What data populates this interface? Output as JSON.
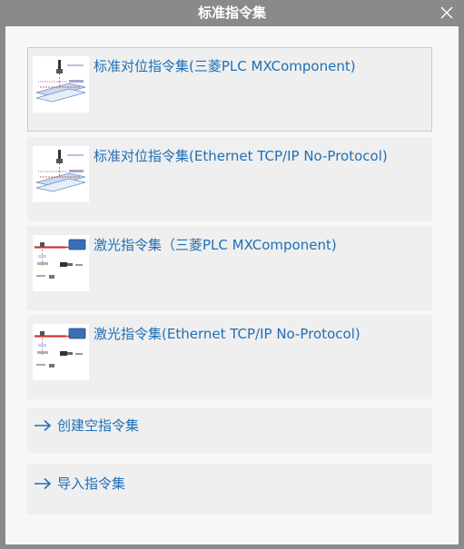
{
  "window": {
    "title": "标准指令集",
    "close_icon": "close-icon"
  },
  "templates": [
    {
      "label": "标准对位指令集(三菱PLC MXComponent)",
      "icon": "alignment-diagram-icon",
      "selected": true
    },
    {
      "label": "标准对位指令集(Ethernet TCP/IP No-Protocol)",
      "icon": "alignment-diagram-icon",
      "selected": false
    },
    {
      "label": "激光指令集（三菱PLC MXComponent)",
      "icon": "laser-diagram-icon",
      "selected": false
    },
    {
      "label": "激光指令集(Ethernet TCP/IP No-Protocol)",
      "icon": "laser-diagram-icon",
      "selected": false
    }
  ],
  "actions": [
    {
      "label": "创建空指令集",
      "icon": "arrow-right-icon"
    },
    {
      "label": "导入指令集",
      "icon": "arrow-right-icon"
    }
  ],
  "colors": {
    "title_bar": "#8a8a8a",
    "content_bg": "#f7f7f7",
    "card_bg": "#efefef",
    "link_text": "#1f6fb5",
    "selected_border": "#b7cfe8"
  }
}
